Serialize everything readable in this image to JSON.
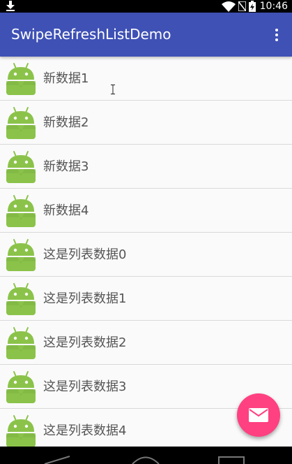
{
  "status_bar": {
    "time": "10:46",
    "icons": [
      "download-icon",
      "wifi-icon",
      "no-sim-icon",
      "battery-charging-icon"
    ]
  },
  "app_bar": {
    "title": "SwipeRefreshListDemo",
    "overflow_icon": "more-vert-icon",
    "color": "#3f51b5"
  },
  "list": {
    "item_icon": "android-icon",
    "items": [
      {
        "label": "新数据1"
      },
      {
        "label": "新数据2"
      },
      {
        "label": "新数据3"
      },
      {
        "label": "新数据4"
      },
      {
        "label": "这是列表数据0"
      },
      {
        "label": "这是列表数据1"
      },
      {
        "label": "这是列表数据2"
      },
      {
        "label": "这是列表数据3"
      },
      {
        "label": "这是列表数据4"
      }
    ]
  },
  "fab": {
    "icon": "mail-icon",
    "color": "#ff4081"
  },
  "nav_bar": {
    "buttons": [
      "back-icon",
      "home-icon",
      "recents-icon"
    ]
  }
}
